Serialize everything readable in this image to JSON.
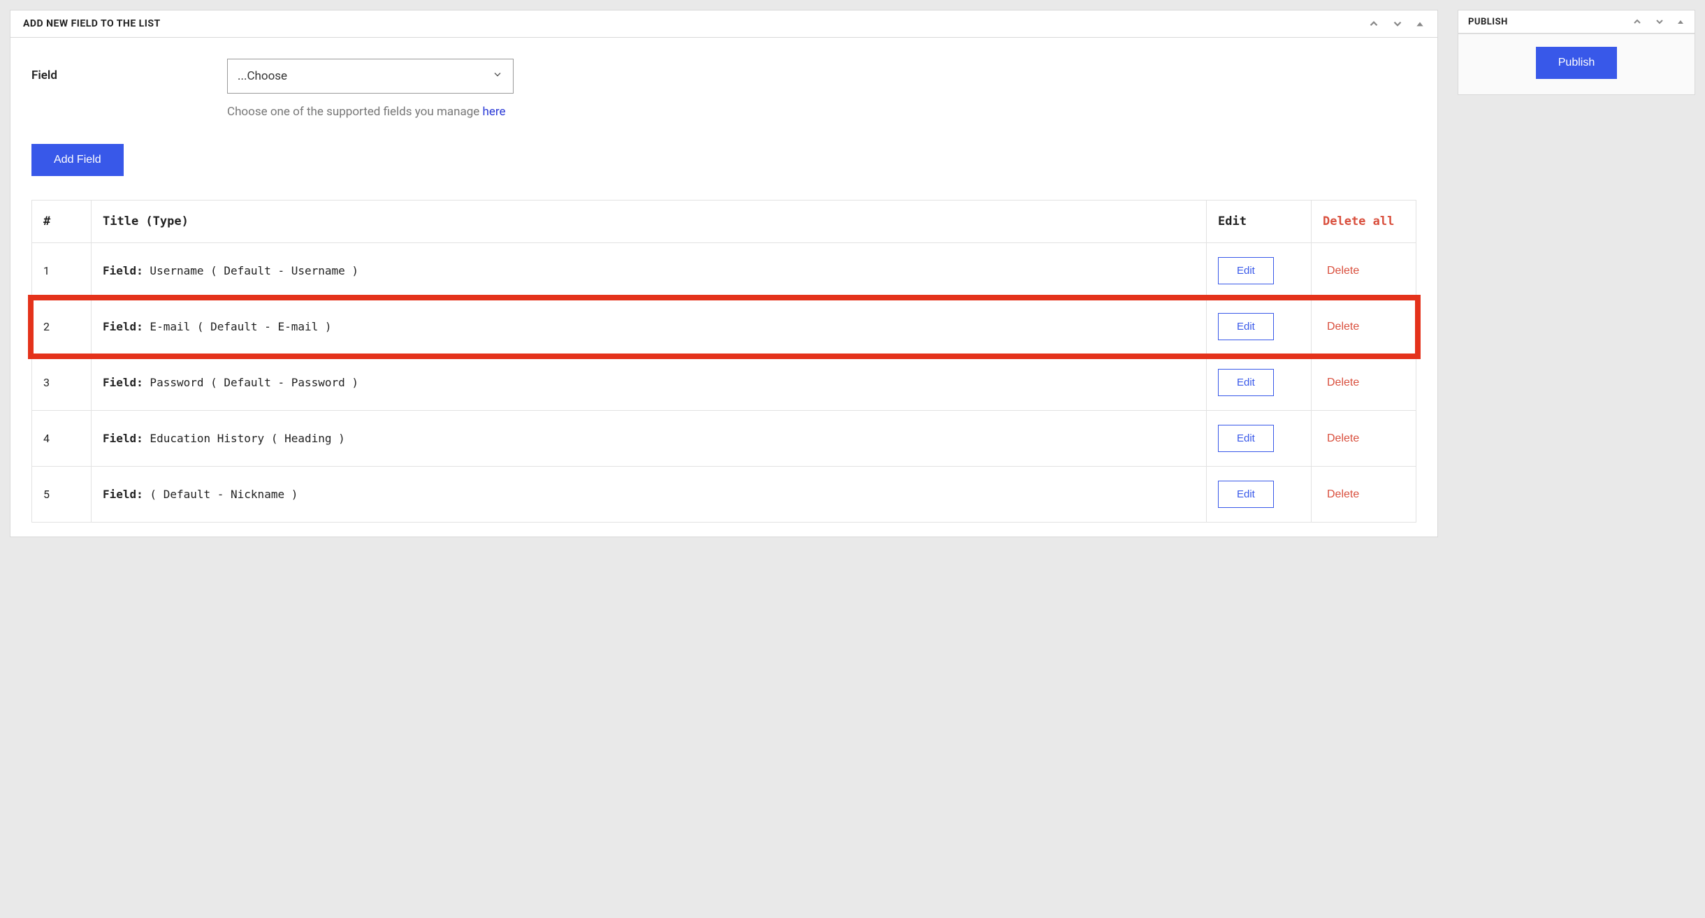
{
  "mainPanel": {
    "title": "ADD NEW FIELD TO THE LIST",
    "fieldLabel": "Field",
    "selectPlaceholder": "...Choose",
    "helperText": "Choose one of the supported fields you manage ",
    "helperLink": "here",
    "addButton": "Add Field"
  },
  "table": {
    "headers": {
      "num": "#",
      "title": "Title (Type)",
      "edit": "Edit",
      "deleteAll": "Delete all"
    },
    "rowPrefix": "Field:",
    "editLabel": "Edit",
    "deleteLabel": "Delete",
    "rows": [
      {
        "num": "1",
        "text": "Username ( Default - Username )",
        "highlighted": false
      },
      {
        "num": "2",
        "text": "E-mail ( Default - E-mail )",
        "highlighted": true
      },
      {
        "num": "3",
        "text": "Password ( Default - Password )",
        "highlighted": false
      },
      {
        "num": "4",
        "text": "Education History ( Heading )",
        "highlighted": false
      },
      {
        "num": "5",
        "text": " ( Default - Nickname )",
        "highlighted": false
      }
    ]
  },
  "sidebar": {
    "title": "PUBLISH",
    "publishButton": "Publish"
  }
}
